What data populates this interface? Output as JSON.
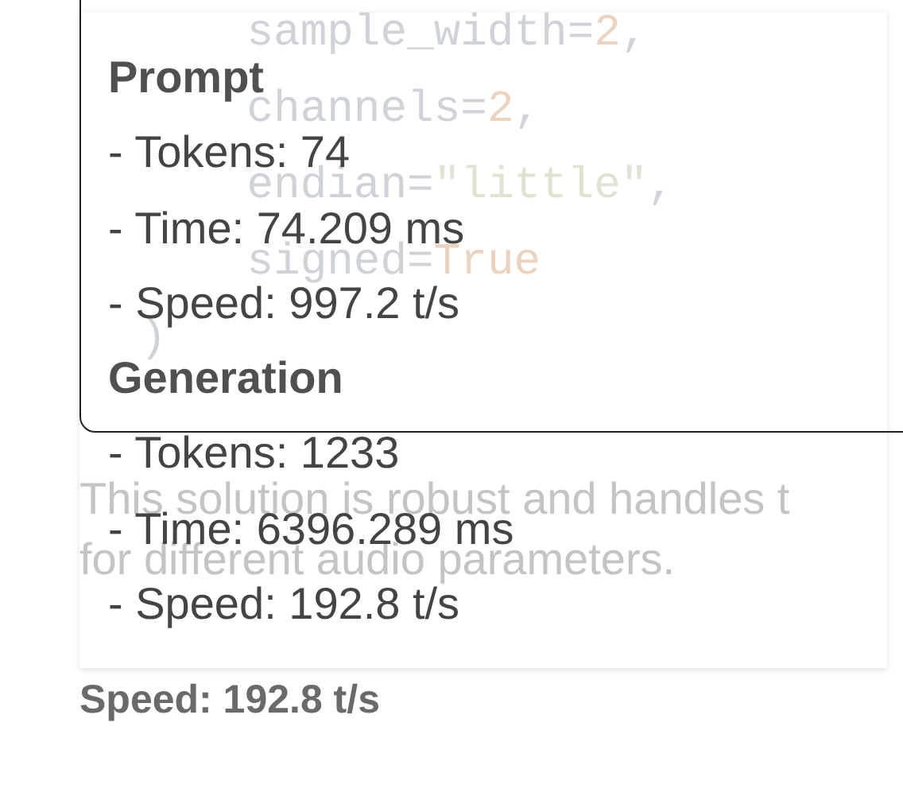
{
  "message": {
    "code_lines": [
      [
        {
          "kind": "plain",
          "text": "    sample_width="
        },
        {
          "kind": "number",
          "text": "2"
        },
        {
          "kind": "plain",
          "text": ","
        }
      ],
      [
        {
          "kind": "plain",
          "text": "    channels="
        },
        {
          "kind": "number",
          "text": "2"
        },
        {
          "kind": "plain",
          "text": ","
        }
      ],
      [
        {
          "kind": "plain",
          "text": "    endian="
        },
        {
          "kind": "string",
          "text": "\"little\""
        },
        {
          "kind": "plain",
          "text": ","
        }
      ],
      [
        {
          "kind": "plain",
          "text": "    signed="
        },
        {
          "kind": "keyword",
          "text": "True"
        }
      ],
      [
        {
          "kind": "plain",
          "text": ")"
        }
      ]
    ],
    "paragraph_lines": [
      "This solution is robust and handles t",
      "for different audio parameters."
    ]
  },
  "speed_label": "Speed: 192.8 t/s",
  "tooltip": {
    "sections": [
      {
        "heading": "Prompt",
        "lines": [
          "- Tokens: 74",
          "- Time: 74.209 ms",
          "- Speed: 997.2 t/s"
        ]
      },
      {
        "heading": "Generation",
        "lines": [
          "- Tokens: 1233",
          "- Time: 6396.289 ms",
          "- Speed: 192.8 t/s"
        ]
      }
    ]
  }
}
